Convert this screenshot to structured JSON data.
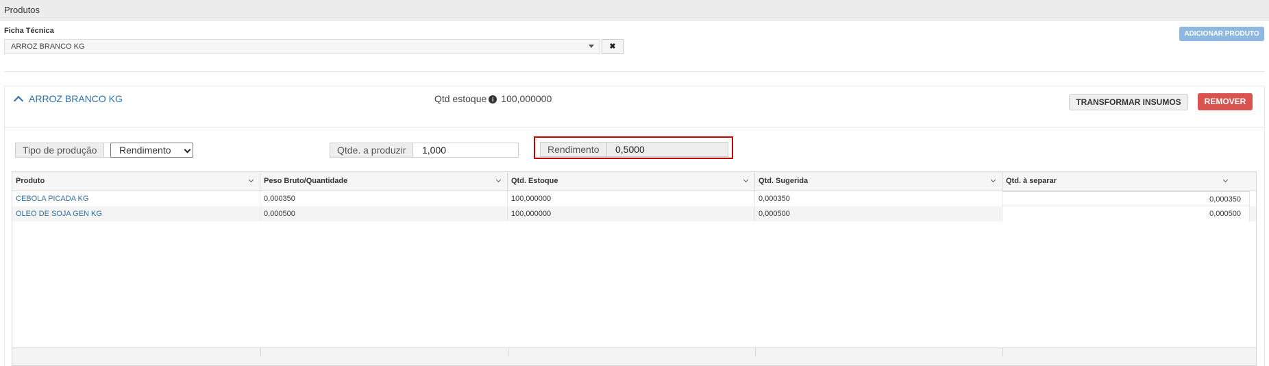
{
  "header": {
    "title": "Produtos"
  },
  "ficha": {
    "label": "Ficha Técnica",
    "selected": "ARROZ BRANCO KG",
    "clear_label": "✖"
  },
  "actions": {
    "add_product": "ADICIONAR PRODUTO"
  },
  "product": {
    "name": "ARROZ BRANCO KG",
    "stock_label": "Qtd estoque",
    "stock_value": "100,000000",
    "transform_label": "TRANSFORMAR INSUMOS",
    "remove_label": "REMOVER"
  },
  "form": {
    "tipo_label": "Tipo de produção",
    "tipo_value": "Rendimento",
    "qtde_label": "Qtde. a produzir",
    "qtde_value": "1,000",
    "rendimento_label": "Rendimento",
    "rendimento_value": "0,5000"
  },
  "grid": {
    "columns": [
      "Produto",
      "Peso Bruto/Quantidade",
      "Qtd. Estoque",
      "Qtd. Sugerida",
      "Qtd. à separar"
    ],
    "rows": [
      [
        "CEBOLA PICADA KG",
        "0,000350",
        "100,000000",
        "0,000350",
        "0,000350"
      ],
      [
        "OLEO DE SOJA GEN KG",
        "0,000500",
        "100,000000",
        "0,000500",
        "0,000500"
      ]
    ]
  },
  "colors": {
    "accent": "#2e6da4",
    "danger": "#d9534f",
    "add_button": "#8fb8e0",
    "highlight": "#c40000"
  }
}
